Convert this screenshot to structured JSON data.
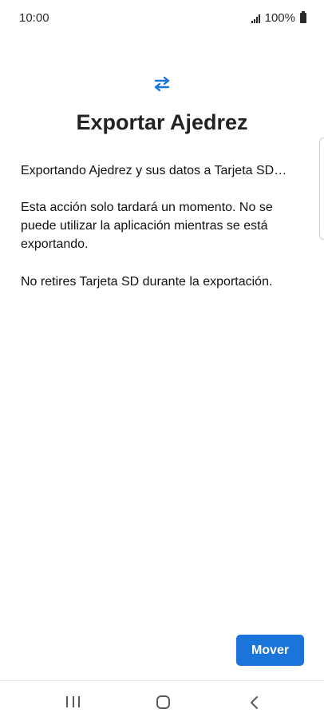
{
  "status_bar": {
    "time": "10:00",
    "battery_percent": "100%",
    "icons": [
      "signal-icon",
      "battery-icon"
    ]
  },
  "header": {
    "icon": "transfer-arrows-icon",
    "title": "Exportar Ajedrez"
  },
  "content": {
    "paragraph_1": "Exportando Ajedrez y sus datos a Tarjeta SD…",
    "paragraph_2": "Esta acción solo tardará un momento. No se puede utilizar la aplicación mientras se está exportando.",
    "paragraph_3": "No retires Tarjeta SD durante la exportación."
  },
  "actions": {
    "move_label": "Mover"
  },
  "nav_bar": {
    "icons": [
      "recent-apps-icon",
      "home-icon",
      "back-icon"
    ]
  },
  "colors": {
    "accent": "#1b74d9",
    "text": "#111111",
    "background": "#ffffff"
  }
}
